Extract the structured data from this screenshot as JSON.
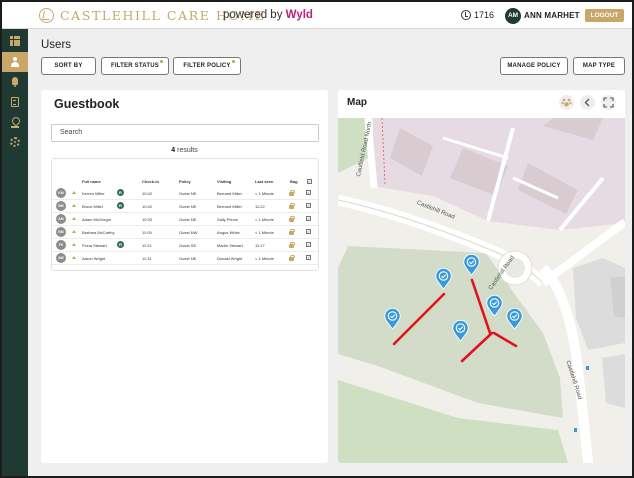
{
  "header": {
    "brand": "CASTLEHILL CARE HOME",
    "powered_prefix": "powered by",
    "powered_brand": "Wyld",
    "clock_value": "1716",
    "user_initials": "AM",
    "user_name": "ANN MARHET",
    "logout_label": "LOGOUT"
  },
  "sidebar": {
    "items": [
      {
        "icon": "grid-icon",
        "active": false
      },
      {
        "icon": "user-icon",
        "active": true
      },
      {
        "icon": "bell-icon",
        "active": false
      },
      {
        "icon": "document-icon",
        "active": false
      },
      {
        "icon": "location-pin-icon",
        "active": false
      },
      {
        "icon": "gear-icon",
        "active": false
      }
    ]
  },
  "page": {
    "title": "Users"
  },
  "toolbar": {
    "sort_label": "SORT BY",
    "filter_status_label": "FILTER STATUS",
    "filter_policy_label": "FILTER POLICY",
    "manage_policy_label": "MANAGE POLICY",
    "map_type_label": "MAP TYPE"
  },
  "guestbook": {
    "title": "Guestbook",
    "search_placeholder": "Search",
    "results_count": "4",
    "results_suffix": "results",
    "columns": {
      "full_name": "Full name",
      "check_in": "Check-in",
      "policy": "Policy",
      "visiting": "Visiting",
      "last_seen": "Last seen",
      "bag": "Bag"
    },
    "rows": [
      {
        "initials": "KM",
        "name": "Kerren Miller",
        "badge": "R",
        "check_in": "10:42",
        "policy": "Guest NE",
        "visiting": "Bernard Miller",
        "last_seen": "< 1 Minute",
        "checked": true
      },
      {
        "initials": "BM",
        "name": "Bruce Miller",
        "badge": "R",
        "check_in": "10:42",
        "policy": "Guest NE",
        "visiting": "Bernard Miller",
        "last_seen": "11:22",
        "checked": true
      },
      {
        "initials": "AM",
        "name": "Adam McGregor",
        "badge": "",
        "check_in": "10:33",
        "policy": "Guest NE",
        "visiting": "Sally Pierce",
        "last_seen": "< 1 Minute",
        "checked": true
      },
      {
        "initials": "BM",
        "name": "Barbara McCarthy",
        "badge": "",
        "check_in": "11:05",
        "policy": "Guest NW",
        "visiting": "Angus White",
        "last_seen": "< 1 Minute",
        "checked": true
      },
      {
        "initials": "FS",
        "name": "Fiona Stewart",
        "badge": "R",
        "check_in": "11:21",
        "policy": "Guest SE",
        "visiting": "Martin Stewart",
        "last_seen": "11:17",
        "checked": true
      },
      {
        "initials": "AW",
        "name": "Aaron Wright",
        "badge": "",
        "check_in": "11:31",
        "policy": "Guest NE",
        "visiting": "Donald Wright",
        "last_seen": "< 1 Minute",
        "checked": true
      }
    ]
  },
  "map": {
    "title": "Map",
    "streets": {
      "caulfield_road_north": "Caulfield Road North",
      "castlehill_road_1": "Castlehill Road",
      "castlehill_road_2": "Castlehill Road",
      "castlehill_road_3": "Castlehill Road"
    },
    "colors": {
      "pin": "#3a9ad9",
      "track": "#e0141e",
      "grass": "#d3dcc9",
      "building": "#d9ccd1"
    }
  }
}
